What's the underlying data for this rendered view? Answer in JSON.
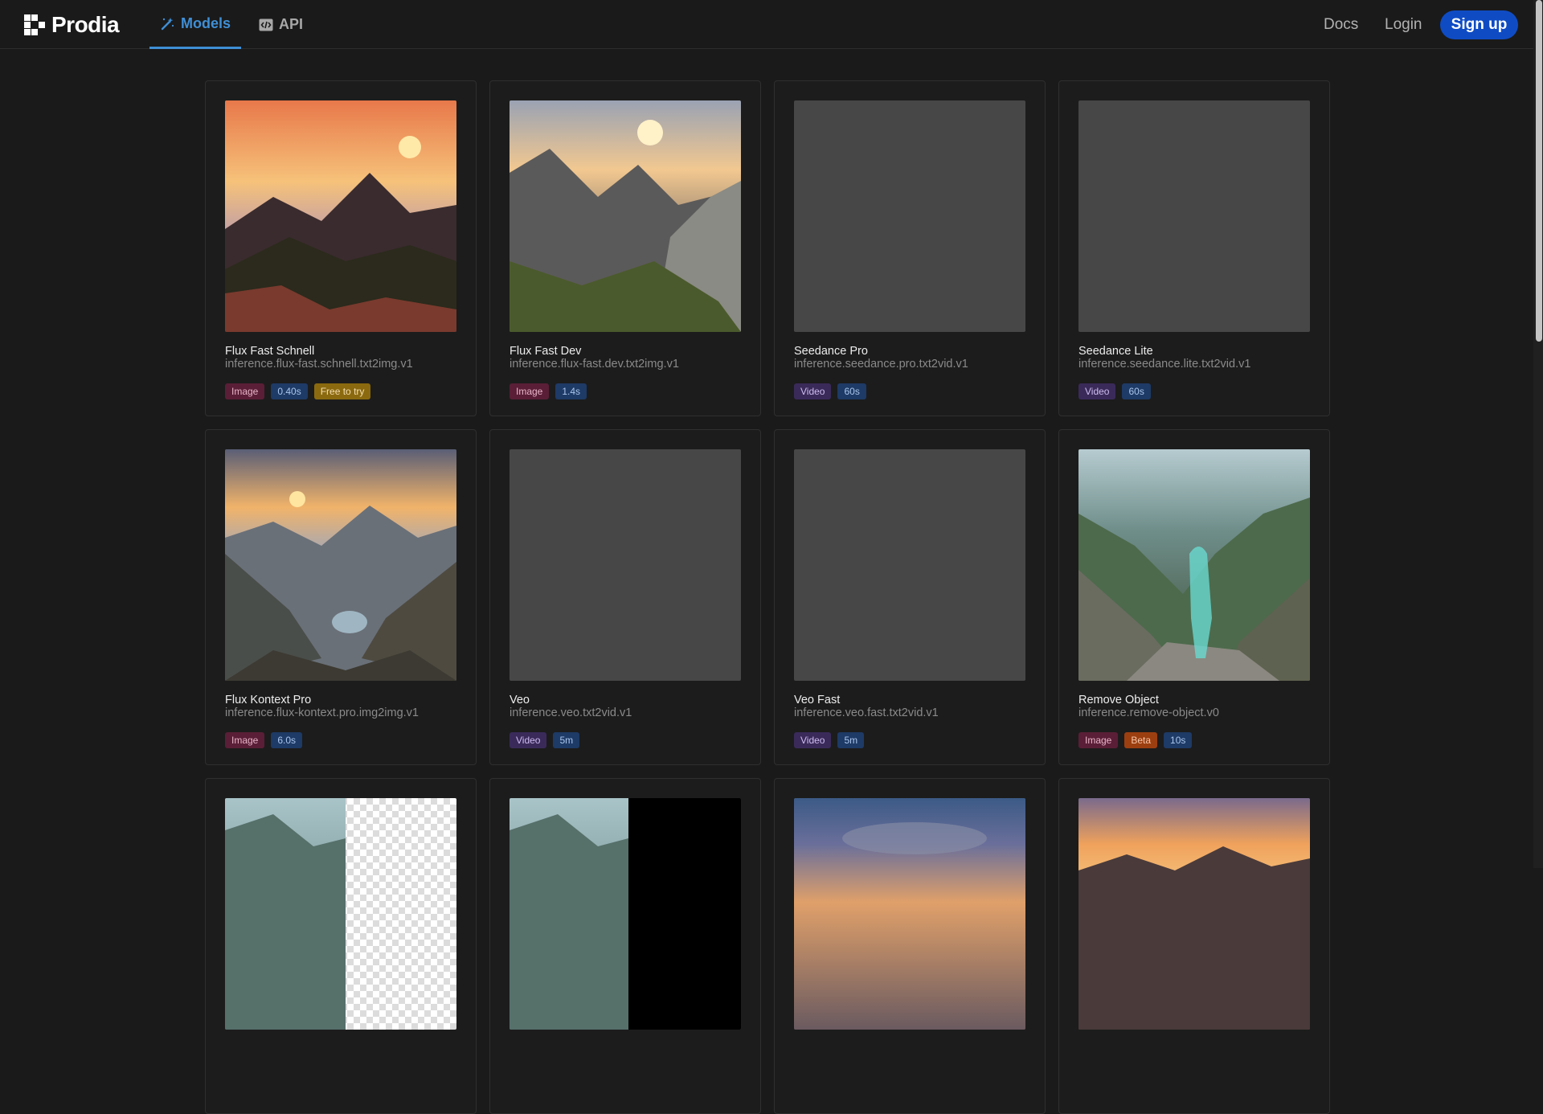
{
  "header": {
    "brand": "Prodia",
    "tabs": [
      {
        "label": "Models",
        "icon": "wand-icon",
        "active": true
      },
      {
        "label": "API",
        "icon": "code-icon",
        "active": false
      }
    ],
    "docs": "Docs",
    "login": "Login",
    "signup": "Sign up"
  },
  "colors": {
    "accent": "#3f8fd6",
    "signup_bg": "#0f4cc4",
    "background": "#1a1a1a"
  },
  "models": [
    {
      "title": "Flux Fast Schnell",
      "id": "inference.flux-fast.schnell.txt2img.v1",
      "tags": [
        "Image",
        "0.40s",
        "Free to try"
      ]
    },
    {
      "title": "Flux Fast Dev",
      "id": "inference.flux-fast.dev.txt2img.v1",
      "tags": [
        "Image",
        "1.4s"
      ]
    },
    {
      "title": "Seedance Pro",
      "id": "inference.seedance.pro.txt2vid.v1",
      "tags": [
        "Video",
        "60s"
      ]
    },
    {
      "title": "Seedance Lite",
      "id": "inference.seedance.lite.txt2vid.v1",
      "tags": [
        "Video",
        "60s"
      ]
    },
    {
      "title": "Flux Kontext Pro",
      "id": "inference.flux-kontext.pro.img2img.v1",
      "tags": [
        "Image",
        "6.0s"
      ]
    },
    {
      "title": "Veo",
      "id": "inference.veo.txt2vid.v1",
      "tags": [
        "Video",
        "5m"
      ]
    },
    {
      "title": "Veo Fast",
      "id": "inference.veo.fast.txt2vid.v1",
      "tags": [
        "Video",
        "5m"
      ]
    },
    {
      "title": "Remove Object",
      "id": "inference.remove-object.v0",
      "tags": [
        "Image",
        "Beta",
        "10s"
      ]
    },
    {
      "title": "",
      "id": "",
      "tags": []
    },
    {
      "title": "",
      "id": "",
      "tags": []
    },
    {
      "title": "",
      "id": "",
      "tags": []
    },
    {
      "title": "",
      "id": "",
      "tags": []
    }
  ]
}
